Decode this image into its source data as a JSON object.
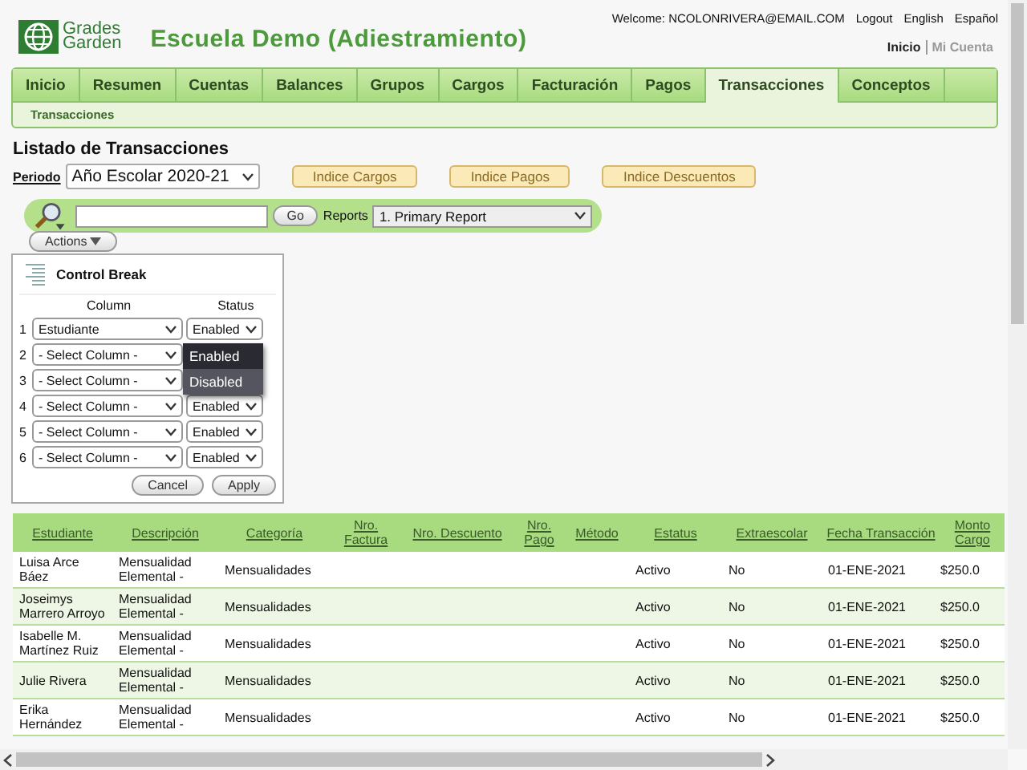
{
  "header": {
    "logo_text": [
      "Grades",
      "Garden"
    ],
    "school": "Escuela Demo (Adiestramiento)",
    "welcome": "Welcome: NCOLONRIVERA@EMAIL.COM",
    "links": [
      "Logout",
      "English",
      "Español"
    ],
    "account_links": [
      {
        "label": "Inicio",
        "selected": true
      },
      {
        "label": "Mi Cuenta",
        "selected": false
      }
    ]
  },
  "nav_tabs": [
    {
      "label": "Inicio",
      "selected": false
    },
    {
      "label": "Resumen",
      "selected": false
    },
    {
      "label": "Cuentas",
      "selected": false
    },
    {
      "label": "Balances",
      "selected": false
    },
    {
      "label": "Grupos",
      "selected": false
    },
    {
      "label": "Cargos",
      "selected": false
    },
    {
      "label": "Facturación",
      "selected": false
    },
    {
      "label": "Pagos",
      "selected": false
    },
    {
      "label": "Transacciones",
      "selected": true
    },
    {
      "label": "Conceptos",
      "selected": false
    }
  ],
  "subnav": [
    "Transacciones"
  ],
  "page_title": "Listado de Transacciones",
  "period": {
    "label": "Periodo",
    "value": "Año Escolar 2020-21"
  },
  "index_buttons": [
    "Indice Cargos",
    "Indice Pagos",
    "Indice Descuentos"
  ],
  "search": {
    "go": "Go",
    "reports_label": "Reports",
    "report": "1. Primary Report",
    "actions": "Actions"
  },
  "control_break": {
    "title": "Control Break",
    "column_header": "Column",
    "status_header": "Status",
    "rows": [
      {
        "number": "1",
        "column": "Estudiante",
        "status": "Enabled"
      },
      {
        "number": "2",
        "column": "- Select Column -"
      },
      {
        "number": "3",
        "column": "- Select Column -"
      },
      {
        "number": "4",
        "column": "- Select Column -",
        "status": "Enabled"
      },
      {
        "number": "5",
        "column": "- Select Column -",
        "status": "Enabled"
      },
      {
        "number": "6",
        "column": "- Select Column -",
        "status": "Enabled"
      }
    ],
    "status_menu": [
      {
        "label": "Enabled",
        "selected": false
      },
      {
        "label": "Disabled",
        "selected": true
      }
    ],
    "buttons": [
      "Cancel",
      "Apply"
    ]
  },
  "table": {
    "columns": [
      "Estudiante",
      "Descripción",
      "Categoría",
      "Nro. Factura",
      "Nro. Descuento",
      "Nro. Pago",
      "Método",
      "Estatus",
      "Extraescolar",
      "Fecha Transacción",
      "Monto Cargo"
    ],
    "rows": [
      [
        "Luisa Arce Báez",
        "Mensualidad Elemental -",
        "Mensualidades",
        "",
        "",
        "",
        "",
        "Activo",
        "No",
        "01-ENE-2021",
        "$250.0"
      ],
      [
        "Joseimys Marrero Arroyo",
        "Mensualidad Elemental -",
        "Mensualidades",
        "",
        "",
        "",
        "",
        "Activo",
        "No",
        "01-ENE-2021",
        "$250.0"
      ],
      [
        "Isabelle M. Martínez Ruiz",
        "Mensualidad Elemental -",
        "Mensualidades",
        "",
        "",
        "",
        "",
        "Activo",
        "No",
        "01-ENE-2021",
        "$250.0"
      ],
      [
        "Julie Rivera",
        "Mensualidad Elemental -",
        "Mensualidades",
        "",
        "",
        "",
        "",
        "Activo",
        "No",
        "01-ENE-2021",
        "$250.0"
      ],
      [
        "Erika Hernández",
        "Mensualidad Elemental -",
        "Mensualidades",
        "",
        "",
        "",
        "",
        "Activo",
        "No",
        "01-ENE-2021",
        "$250.0"
      ]
    ]
  }
}
